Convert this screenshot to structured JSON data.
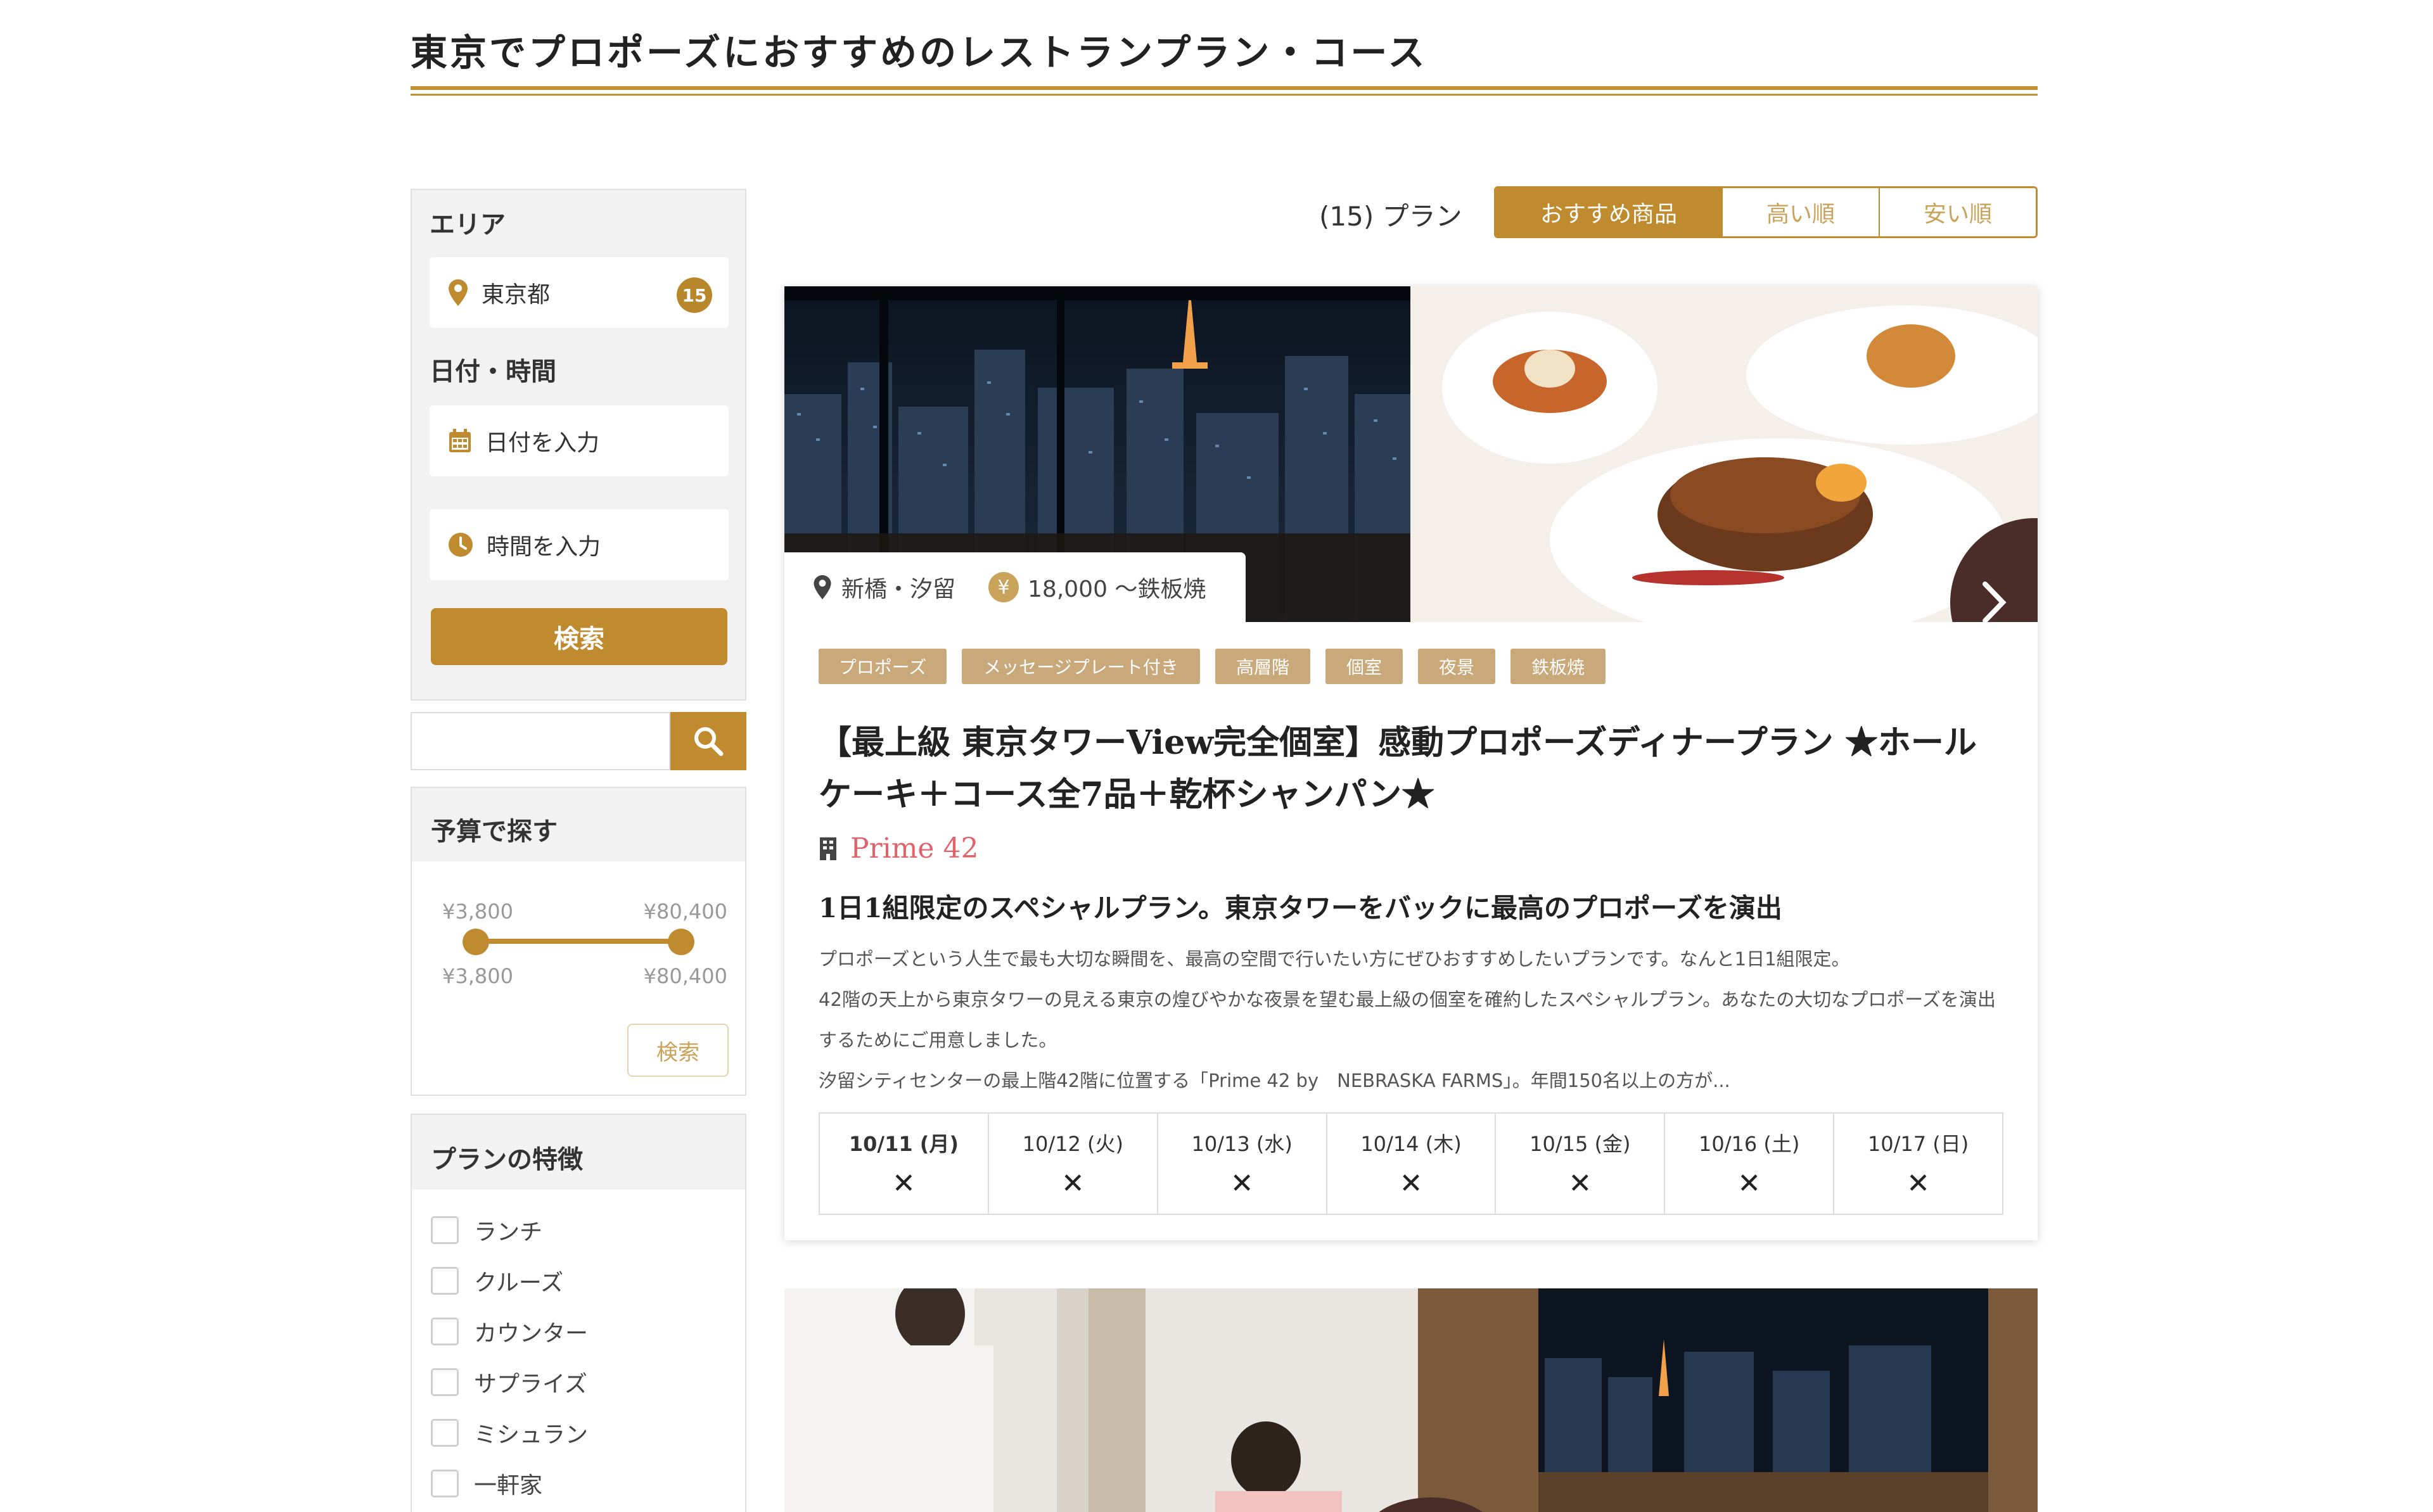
{
  "page": {
    "title": "東京でプロポーズにおすすめのレストランプラン・コース"
  },
  "sidebar": {
    "area": {
      "heading": "エリア",
      "value": "東京都",
      "count": "15"
    },
    "datetime": {
      "heading": "日付・時間",
      "date_placeholder": "日付を入力",
      "time_placeholder": "時間を入力",
      "search_label": "検索"
    },
    "budget": {
      "heading": "予算で探す",
      "min_top": "¥3,800",
      "max_top": "¥80,400",
      "min_bottom": "¥3,800",
      "max_bottom": "¥80,400",
      "search_label": "検索",
      "range_min": 3800,
      "range_max": 80400,
      "selected_min": 3800,
      "selected_max": 80400
    },
    "features": {
      "heading": "プランの特徴",
      "items": [
        "ランチ",
        "クルーズ",
        "カウンター",
        "サプライズ",
        "ミシュラン",
        "一軒家"
      ]
    }
  },
  "results": {
    "count_label": "(15) プラン",
    "sort": [
      "おすすめ商品",
      "高い順",
      "安い順"
    ],
    "active_sort": "おすすめ商品"
  },
  "card": {
    "location": "新橋・汐留",
    "price": "18,000 〜鉄板焼",
    "yen_symbol": "¥",
    "tags": [
      "プロポーズ",
      "メッセージプレート付き",
      "高層階",
      "個室",
      "夜景",
      "鉄板焼"
    ],
    "title_line1": "【最上級 東京タワーView完全個室】感動プロポーズディナープラン ★ホール",
    "title_line2": "ケーキ＋コース全7品＋乾杯シャンパン★",
    "restaurant": "Prime 42",
    "subtitle": "1日1組限定のスペシャルプラン。東京タワーをバックに最高のプロポーズを演出",
    "desc": [
      "プロポーズという人生で最も大切な瞬間を、最高の空間で行いたい方にぜひおすすめしたいプランです。なんと1日1組限定。",
      "42階の天上から東京タワーの見える東京の煌びやかな夜景を望む最上級の個室を確約したスペシャルプラン。あなたの大切なプロポーズを演出",
      "するためにご用意しました。",
      "汐留シティセンターの最上階42階に位置する「Prime 42 by　NEBRASKA FARMS」。年間150名以上の方が..."
    ],
    "calendar": [
      {
        "date": "10/11 (月)",
        "mark": "✕"
      },
      {
        "date": "10/12 (火)",
        "mark": "✕"
      },
      {
        "date": "10/13 (水)",
        "mark": "✕"
      },
      {
        "date": "10/14 (木)",
        "mark": "✕"
      },
      {
        "date": "10/15 (金)",
        "mark": "✕"
      },
      {
        "date": "10/16 (土)",
        "mark": "✕"
      },
      {
        "date": "10/17 (日)",
        "mark": "✕"
      }
    ]
  },
  "colors": {
    "gold": "#c08a2e",
    "tag": "#c9a87a",
    "restaurant": "#e0626b",
    "next_button": "#4a2c28"
  }
}
